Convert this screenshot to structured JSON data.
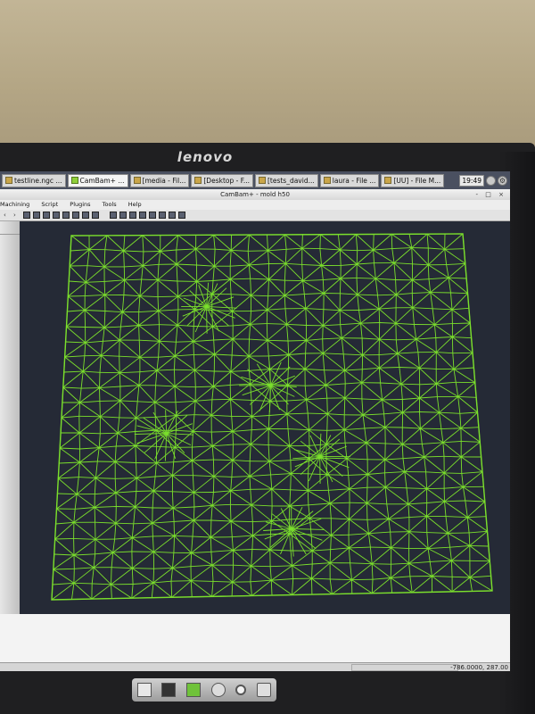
{
  "monitor": {
    "brand": "lenovo"
  },
  "taskbar": {
    "tasks": [
      {
        "label": "testline.ngc ...",
        "icon": "document-icon"
      },
      {
        "label": "CamBam+ ...",
        "icon": "cambam-icon"
      },
      {
        "label": "[media - Fil...",
        "icon": "folder-icon"
      },
      {
        "label": "[Desktop - F...",
        "icon": "folder-icon"
      },
      {
        "label": "[tests_david...",
        "icon": "folder-icon"
      },
      {
        "label": "laura - File ...",
        "icon": "folder-icon"
      },
      {
        "label": "[UU] - File M...",
        "icon": "folder-icon"
      }
    ],
    "clock": "19:49"
  },
  "window": {
    "title": "CamBam+ - mold h50",
    "controls": "- □ ×"
  },
  "menu": [
    "Machining",
    "Script",
    "Plugins",
    "Tools",
    "Help"
  ],
  "toolbar": {
    "nav": [
      "‹",
      "›"
    ],
    "buttons_group1": [
      "view-top",
      "view-front",
      "view-side",
      "view-iso",
      "zoom-fit",
      "text",
      "grid",
      "snap"
    ],
    "buttons_group2": [
      "select",
      "line",
      "arc",
      "rect",
      "circle",
      "poly",
      "point",
      "dim"
    ]
  },
  "mesh": {
    "color": "#7be02c",
    "background": "#252a36"
  },
  "statusbar": {
    "coords": "-786.0000, 287.00"
  },
  "dock": [
    "window-icon",
    "terminal-icon",
    "cambam-icon",
    "disk-icon",
    "search-icon",
    "folder-icon"
  ]
}
